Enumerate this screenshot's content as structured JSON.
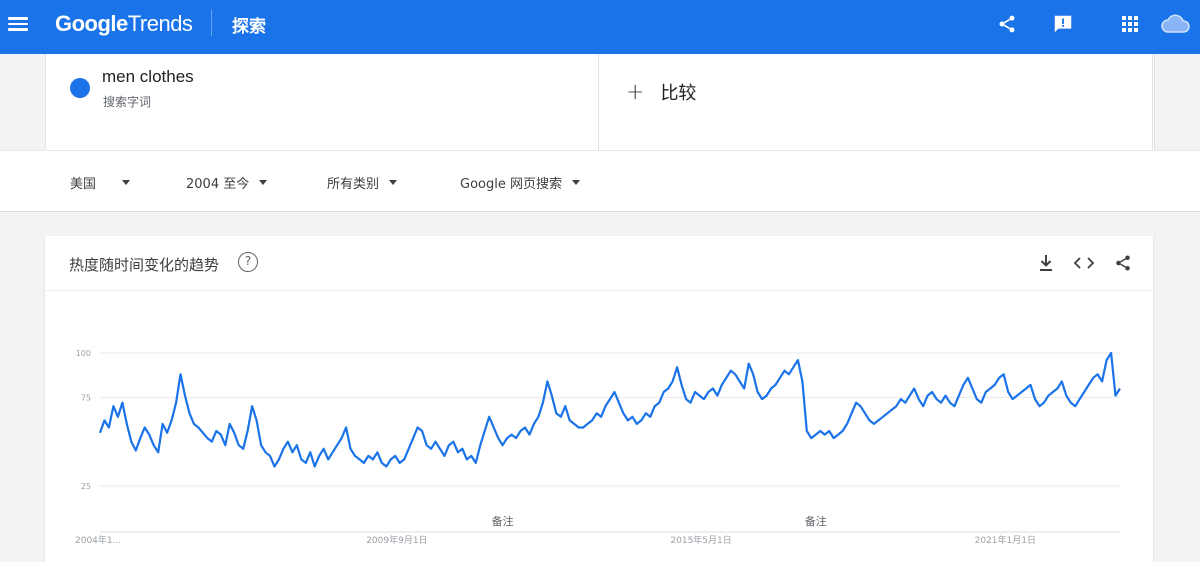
{
  "header": {
    "brand_bold": "Google",
    "brand_light": "Trends",
    "section_title": "探索",
    "icons": [
      "share-icon",
      "feedback-icon",
      "apps-grid-icon",
      "account-cloud-icon"
    ]
  },
  "term": {
    "name": "men clothes",
    "type": "搜索字词",
    "color": "#1a73e8",
    "compare_label": "比较"
  },
  "filters": [
    {
      "label": "美国"
    },
    {
      "label": "2004 至今"
    },
    {
      "label": "所有类别"
    },
    {
      "label": "Google 网页搜索"
    }
  ],
  "chart_card": {
    "title": "热度随时间变化的趋势",
    "help_glyph": "?",
    "icons": [
      "download-icon",
      "embed-code-icon",
      "share-icon"
    ]
  },
  "colors": {
    "topbar": "#1a73e8",
    "line": "#1a73e8",
    "grid": "#e8e8e8"
  },
  "chart_data": {
    "type": "line",
    "title": "热度随时间变化的趋势",
    "ylim": [
      0,
      100
    ],
    "y_ticks": [
      "100",
      "75",
      "25"
    ],
    "y_tick_values": [
      100,
      75,
      25
    ],
    "x_tick_labels": [
      "2004年1...",
      "2009年9月1日",
      "2015年5月1日",
      "2021年1月1日"
    ],
    "x_tick_positions": [
      0,
      68,
      136,
      204
    ],
    "annotations": [
      {
        "label": "备注",
        "index": 90
      },
      {
        "label": "备注",
        "index": 160
      }
    ],
    "grid": true,
    "series": [
      {
        "values": [
          55,
          62,
          58,
          70,
          64,
          72,
          60,
          50,
          45,
          52,
          58,
          54,
          48,
          44,
          60,
          55,
          62,
          72,
          88,
          76,
          66,
          60,
          58,
          55,
          52,
          50,
          56,
          54,
          48,
          60,
          55,
          48,
          46,
          56,
          70,
          62,
          48,
          44,
          42,
          36,
          40,
          46,
          50,
          44,
          48,
          40,
          38,
          44,
          36,
          42,
          46,
          40,
          44,
          48,
          52,
          58,
          46,
          42,
          40,
          38,
          42,
          40,
          44,
          38,
          36,
          40,
          42,
          38,
          40,
          46,
          52,
          58,
          56,
          48,
          46,
          50,
          46,
          42,
          48,
          50,
          44,
          46,
          40,
          42,
          38,
          48,
          56,
          64,
          58,
          52,
          48,
          52,
          54,
          52,
          56,
          58,
          54,
          60,
          64,
          72,
          84,
          76,
          66,
          64,
          70,
          62,
          60,
          58,
          58,
          60,
          62,
          66,
          64,
          70,
          74,
          78,
          72,
          66,
          62,
          64,
          60,
          62,
          66,
          64,
          70,
          72,
          78,
          80,
          84,
          92,
          82,
          74,
          72,
          78,
          76,
          74,
          78,
          80,
          76,
          82,
          86,
          90,
          88,
          84,
          80,
          94,
          88,
          78,
          74,
          76,
          80,
          82,
          86,
          90,
          88,
          92,
          96,
          84,
          56,
          52,
          54,
          56,
          54,
          56,
          52,
          54,
          56,
          60,
          66,
          72,
          70,
          66,
          62,
          60,
          62,
          64,
          66,
          68,
          70,
          74,
          72,
          76,
          80,
          74,
          70,
          76,
          78,
          74,
          72,
          76,
          72,
          70,
          76,
          82,
          86,
          80,
          74,
          72,
          78,
          80,
          82,
          86,
          88,
          78,
          74,
          76,
          78,
          80,
          82,
          74,
          70,
          72,
          76,
          78,
          80,
          84,
          76,
          72,
          70,
          74,
          78,
          82,
          86,
          88,
          84,
          96,
          100,
          76,
          80
        ]
      }
    ]
  }
}
